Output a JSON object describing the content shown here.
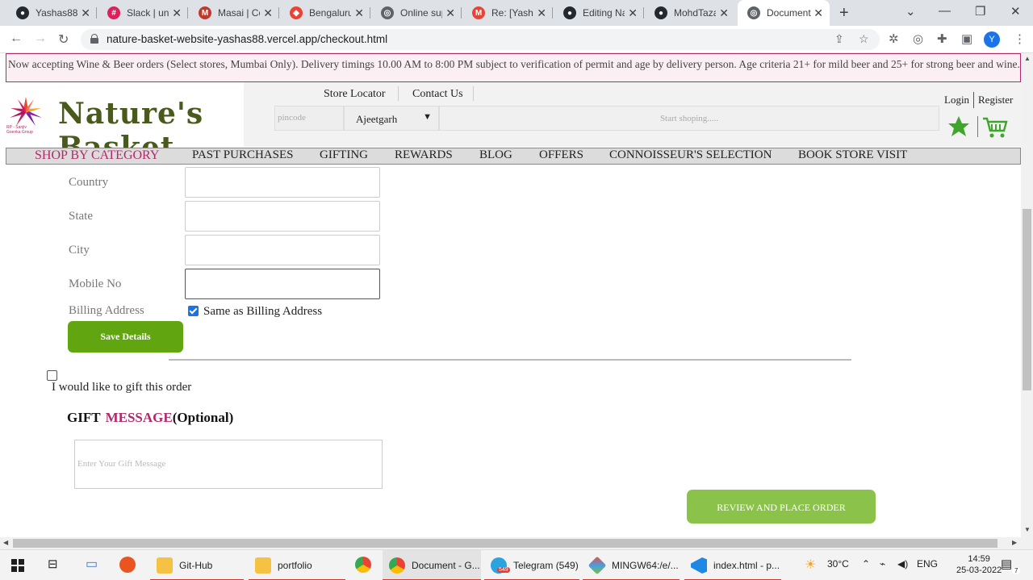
{
  "browser": {
    "tabs": [
      {
        "title": "Yashas88/",
        "icon": "github-icon",
        "color": "#24292f"
      },
      {
        "title": "Slack | unit",
        "icon": "slack-icon",
        "color": "#e01e5a"
      },
      {
        "title": "Masai | Co",
        "icon": "masai-icon",
        "color": "#c0392b"
      },
      {
        "title": "Bengaluru",
        "icon": "maps-icon",
        "color": "#ea4335"
      },
      {
        "title": "Online sup",
        "icon": "globe-icon",
        "color": "#5f6368"
      },
      {
        "title": "Re: [Yasha",
        "icon": "gmail-icon",
        "color": "#ea4335"
      },
      {
        "title": "Editing Na",
        "icon": "github-icon",
        "color": "#24292f"
      },
      {
        "title": "MohdTaza",
        "icon": "github-icon",
        "color": "#24292f"
      },
      {
        "title": "Document",
        "icon": "globe-icon",
        "color": "#5f6368"
      }
    ],
    "url": "nature-basket-website-yashas88.vercel.app/checkout.html",
    "profile_initial": "Y"
  },
  "announcement": "Now accepting Wine & Beer orders (Select stores, Mumbai Only). Delivery timings 10.00 AM to 8:00 PM subject to verification of permit and age by delivery person. Age criteria 21+ for mild beer and 25+ for strong beer and wine.",
  "header": {
    "logo_text": "Nature's Basket",
    "logo_sub": "RP - Sanjiv Goenka Group",
    "store_locator": "Store Locator",
    "contact_us": "Contact Us",
    "pincode_placeholder": "pincode",
    "city": "Ajeetgarh",
    "search_placeholder": "Start shoping.....",
    "login": "Login",
    "register": "Register"
  },
  "nav": {
    "items": [
      "SHOP BY CATEGORY",
      "PAST PURCHASES",
      "GIFTING",
      "REWARDS",
      "BLOG",
      "OFFERS",
      "CONNOISSEUR'S SELECTION",
      "BOOK STORE VISIT"
    ]
  },
  "form": {
    "country_label": "Country",
    "state_label": "State",
    "city_label": "City",
    "mobile_label": "Mobile No",
    "billing_label": "Billing Address",
    "same_as_billing": "Same as Billing Address",
    "same_as_billing_checked": true,
    "save_button": "Save Details"
  },
  "gift": {
    "checkbox_label": "I would like to gift this order",
    "checked": false,
    "heading_part1": "GIFT",
    "heading_part2": "MESSAGE",
    "heading_part3": "(Optional)",
    "message_placeholder": "Enter Your Gift Message"
  },
  "place_order_button": "REVIEW AND PLACE ORDER",
  "taskbar": {
    "apps": [
      "Git-Hub",
      "portfolio",
      "Document - G...",
      "Telegram (549)",
      "MINGW64:/e/...",
      "index.html - p..."
    ],
    "telegram_badge": "549",
    "weather": "30°C",
    "language": "ENG",
    "time": "14:59",
    "date": "25-03-2022",
    "notification_count": "7"
  },
  "colors": {
    "brand_pink": "#b02a6a",
    "brand_green": "#4a5a1c",
    "save_green": "#61a611",
    "order_green": "#8bc34a"
  }
}
